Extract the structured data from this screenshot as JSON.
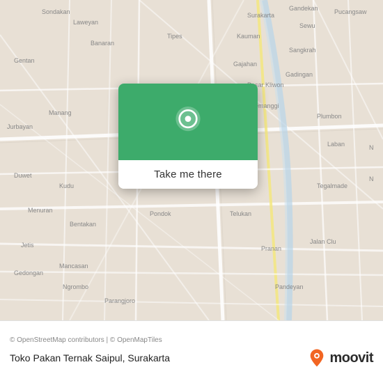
{
  "map": {
    "attribution": "© OpenStreetMap contributors | © OpenMapTiles",
    "center_lat": -7.57,
    "center_lng": 110.75
  },
  "popup": {
    "button_label": "Take me there"
  },
  "bottom_bar": {
    "place_name": "Toko Pakan Ternak Saipul, Surakarta",
    "moovit_brand": "moovit",
    "colors": {
      "green": "#3dab6b",
      "moovit_pin": "#f26522"
    }
  }
}
